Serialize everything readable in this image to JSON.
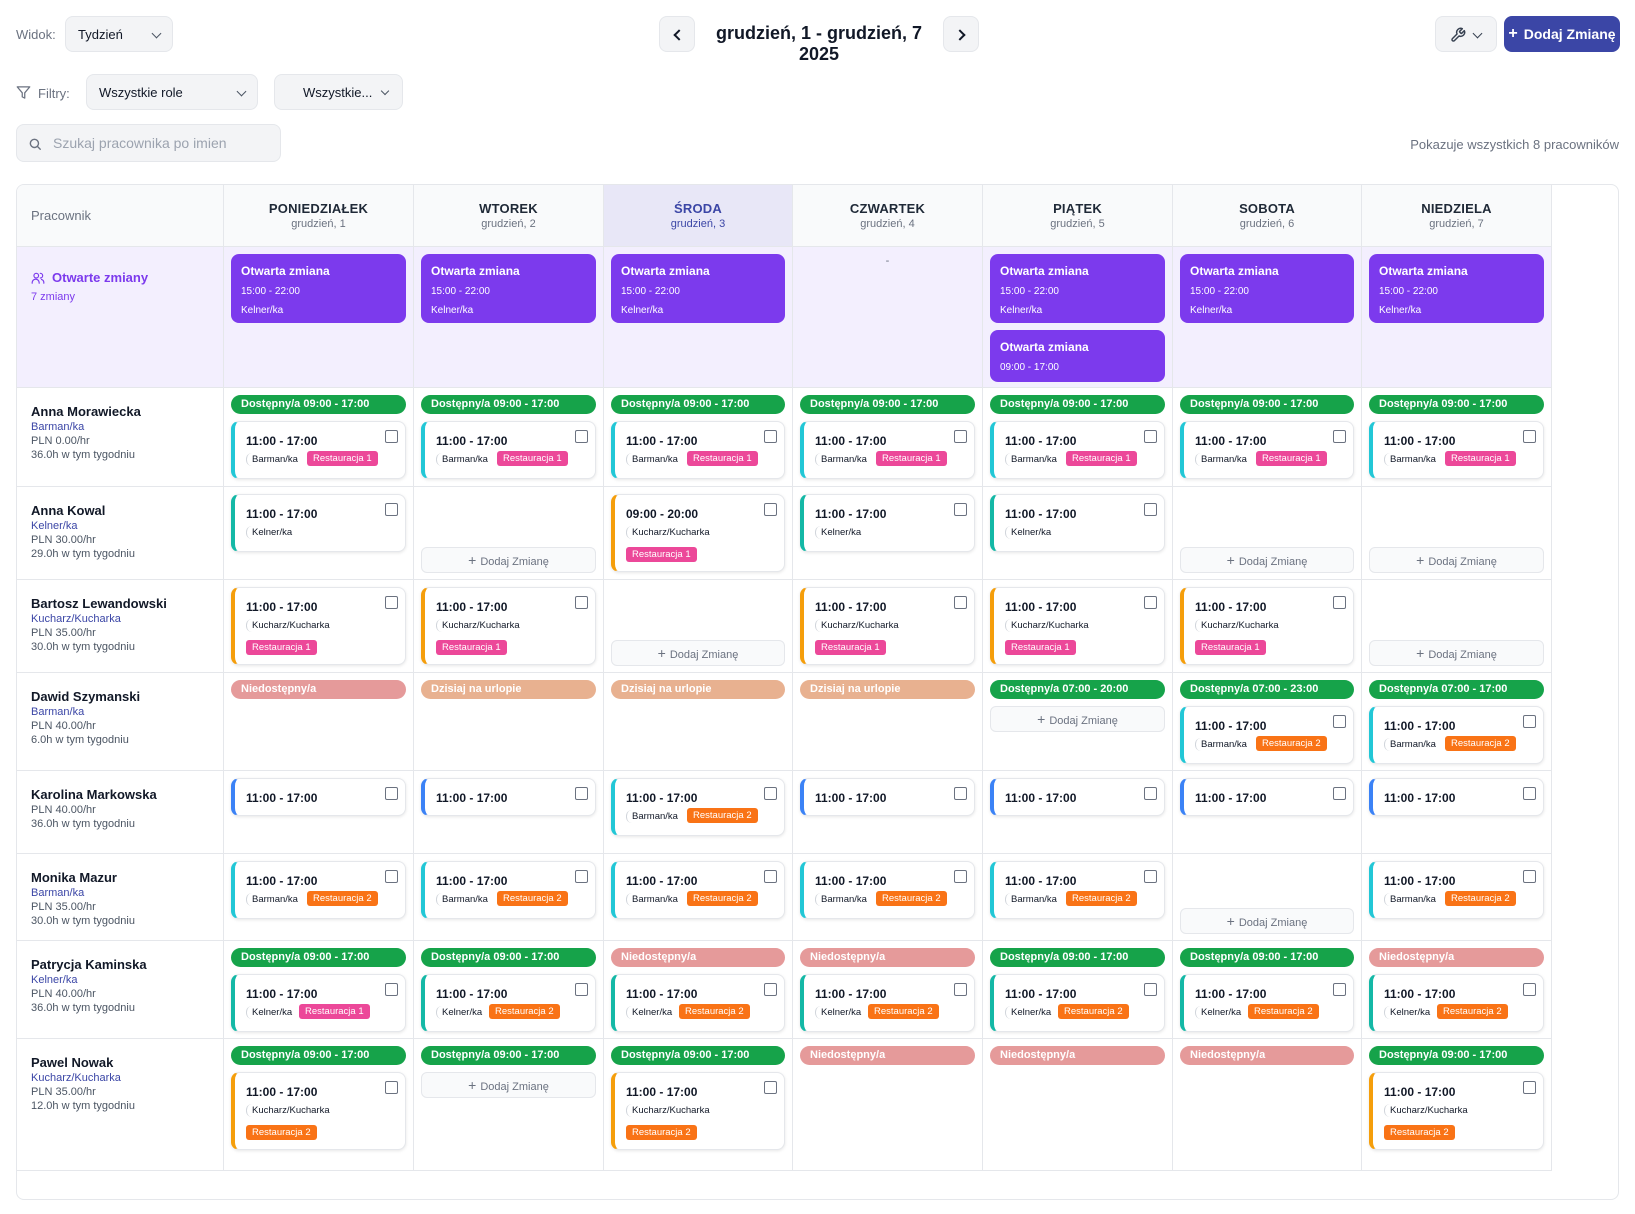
{
  "toolbar": {
    "view_label": "Widok:",
    "view_value": "Tydzień",
    "week_range": "grudzień, 1 - grudzień, 7 2025",
    "add_shift_label": "Dodaj Zmianę"
  },
  "filters": {
    "label": "Filtry:",
    "role_value": "Wszystkie role",
    "location_value": "Wszystkie..."
  },
  "search": {
    "placeholder": "Szukaj pracownika po imien"
  },
  "showing_count": "Pokazuje wszystkich 8 pracowników",
  "colors": {
    "primary": "#3b46a6",
    "open_shift": "#7c3aed",
    "available": "#16a34a",
    "unavailable": "#e59a9a",
    "leave": "#e8b190",
    "location_1": "#ec4899",
    "location_2": "#f97316"
  },
  "grid": {
    "employee_header": "Pracownik",
    "days": [
      {
        "name": "PONIEDZIAŁEK",
        "date": "grudzień, 1"
      },
      {
        "name": "WTOREK",
        "date": "grudzień, 2"
      },
      {
        "name": "ŚRODA",
        "date": "grudzień, 3",
        "today": true
      },
      {
        "name": "CZWARTEK",
        "date": "grudzień, 4"
      },
      {
        "name": "PIĄTEK",
        "date": "grudzień, 5"
      },
      {
        "name": "SOBOTA",
        "date": "grudzień, 6"
      },
      {
        "name": "NIEDZIELA",
        "date": "grudzień, 7"
      }
    ],
    "add_shift_label": "Dodaj Zmianę",
    "open_shifts": {
      "label": "Otwarte zmiany",
      "count": "7 zmiany",
      "empty_marker": "-",
      "days": [
        [
          {
            "title": "Otwarta zmiana",
            "hours": "15:00 - 22:00",
            "role": "Kelner/ka"
          }
        ],
        [
          {
            "title": "Otwarta zmiana",
            "hours": "15:00 - 22:00",
            "role": "Kelner/ka"
          }
        ],
        [
          {
            "title": "Otwarta zmiana",
            "hours": "15:00 - 22:00",
            "role": "Kelner/ka"
          }
        ],
        [],
        [
          {
            "title": "Otwarta zmiana",
            "hours": "15:00 - 22:00",
            "role": "Kelner/ka"
          },
          {
            "title": "Otwarta zmiana",
            "hours": "09:00 - 17:00"
          }
        ],
        [
          {
            "title": "Otwarta zmiana",
            "hours": "15:00 - 22:00",
            "role": "Kelner/ka"
          }
        ],
        [
          {
            "title": "Otwarta zmiana",
            "hours": "15:00 - 22:00",
            "role": "Kelner/ka"
          }
        ]
      ]
    },
    "employees": [
      {
        "name": "Anna Morawiecka",
        "role": "Barman/ka",
        "rate": "PLN 0.00/hr",
        "hours": "36.0h w tym tygodniu",
        "days": [
          {
            "pill": {
              "type": "avail",
              "text": "Dostępny/a 09:00 - 17:00"
            },
            "shift": {
              "time": "11:00 - 17:00",
              "role": "Barman/ka",
              "loc": "Restauracja 1",
              "loc_type": "r1",
              "color": "#22c7d6",
              "layout": "inline"
            }
          },
          {
            "pill": {
              "type": "avail",
              "text": "Dostępny/a 09:00 - 17:00"
            },
            "shift": {
              "time": "11:00 - 17:00",
              "role": "Barman/ka",
              "loc": "Restauracja 1",
              "loc_type": "r1",
              "color": "#22c7d6",
              "layout": "inline"
            }
          },
          {
            "pill": {
              "type": "avail",
              "text": "Dostępny/a 09:00 - 17:00"
            },
            "shift": {
              "time": "11:00 - 17:00",
              "role": "Barman/ka",
              "loc": "Restauracja 1",
              "loc_type": "r1",
              "color": "#22c7d6",
              "layout": "inline"
            }
          },
          {
            "pill": {
              "type": "avail",
              "text": "Dostępny/a 09:00 - 17:00"
            },
            "shift": {
              "time": "11:00 - 17:00",
              "role": "Barman/ka",
              "loc": "Restauracja 1",
              "loc_type": "r1",
              "color": "#22c7d6",
              "layout": "inline"
            }
          },
          {
            "pill": {
              "type": "avail",
              "text": "Dostępny/a 09:00 - 17:00"
            },
            "shift": {
              "time": "11:00 - 17:00",
              "role": "Barman/ka",
              "loc": "Restauracja 1",
              "loc_type": "r1",
              "color": "#22c7d6",
              "layout": "inline"
            }
          },
          {
            "pill": {
              "type": "avail",
              "text": "Dostępny/a 09:00 - 17:00"
            },
            "shift": {
              "time": "11:00 - 17:00",
              "role": "Barman/ka",
              "loc": "Restauracja 1",
              "loc_type": "r1",
              "color": "#22c7d6",
              "layout": "inline"
            }
          },
          {
            "pill": {
              "type": "avail",
              "text": "Dostępny/a 09:00 - 17:00"
            },
            "shift": {
              "time": "11:00 - 17:00",
              "role": "Barman/ka",
              "loc": "Restauracja 1",
              "loc_type": "r1",
              "color": "#22c7d6",
              "layout": "inline"
            }
          }
        ]
      },
      {
        "name": "Anna Kowal",
        "role": "Kelner/ka",
        "rate": "PLN 30.00/hr",
        "hours": "29.0h w tym tygodniu",
        "days": [
          {
            "shift": {
              "time": "11:00 - 17:00",
              "role": "Kelner/ka",
              "color": "#14b8a6",
              "layout": "role-only"
            }
          },
          {
            "add": true
          },
          {
            "shift": {
              "time": "09:00 - 20:00",
              "role": "Kucharz/Kucharka",
              "loc": "Restauracja 1",
              "loc_type": "r1",
              "color": "#f59e0b",
              "layout": "stacked"
            }
          },
          {
            "shift": {
              "time": "11:00 - 17:00",
              "role": "Kelner/ka",
              "color": "#14b8a6",
              "layout": "role-only"
            }
          },
          {
            "shift": {
              "time": "11:00 - 17:00",
              "role": "Kelner/ka",
              "color": "#14b8a6",
              "layout": "role-only"
            }
          },
          {
            "add": true
          },
          {
            "add": true
          }
        ]
      },
      {
        "name": "Bartosz Lewandowski",
        "role": "Kucharz/Kucharka",
        "rate": "PLN 35.00/hr",
        "hours": "30.0h w tym tygodniu",
        "days": [
          {
            "shift": {
              "time": "11:00 - 17:00",
              "role": "Kucharz/Kucharka",
              "loc": "Restauracja 1",
              "loc_type": "r1",
              "color": "#f59e0b",
              "layout": "stacked"
            }
          },
          {
            "shift": {
              "time": "11:00 - 17:00",
              "role": "Kucharz/Kucharka",
              "loc": "Restauracja 1",
              "loc_type": "r1",
              "color": "#f59e0b",
              "layout": "stacked"
            }
          },
          {
            "add": true
          },
          {
            "shift": {
              "time": "11:00 - 17:00",
              "role": "Kucharz/Kucharka",
              "loc": "Restauracja 1",
              "loc_type": "r1",
              "color": "#f59e0b",
              "layout": "stacked"
            }
          },
          {
            "shift": {
              "time": "11:00 - 17:00",
              "role": "Kucharz/Kucharka",
              "loc": "Restauracja 1",
              "loc_type": "r1",
              "color": "#f59e0b",
              "layout": "stacked"
            }
          },
          {
            "shift": {
              "time": "11:00 - 17:00",
              "role": "Kucharz/Kucharka",
              "loc": "Restauracja 1",
              "loc_type": "r1",
              "color": "#f59e0b",
              "layout": "stacked"
            }
          },
          {
            "add": true
          }
        ]
      },
      {
        "name": "Dawid Szymanski",
        "role": "Barman/ka",
        "rate": "PLN 40.00/hr",
        "hours": "6.0h w tym tygodniu",
        "days": [
          {
            "pill": {
              "type": "unavail",
              "text": "Niedostępny/a"
            }
          },
          {
            "pill": {
              "type": "leave",
              "text": "Dzisiaj na urlopie"
            }
          },
          {
            "pill": {
              "type": "leave",
              "text": "Dzisiaj na urlopie"
            }
          },
          {
            "pill": {
              "type": "leave",
              "text": "Dzisiaj na urlopie"
            }
          },
          {
            "pill": {
              "type": "avail",
              "text": "Dostępny/a 07:00 - 20:00"
            },
            "add": true
          },
          {
            "pill": {
              "type": "avail",
              "text": "Dostępny/a 07:00 - 23:00"
            },
            "shift": {
              "time": "11:00 - 17:00",
              "role": "Barman/ka",
              "loc": "Restauracja 2",
              "loc_type": "r2",
              "color": "#22c7d6",
              "layout": "inline"
            }
          },
          {
            "pill": {
              "type": "avail",
              "text": "Dostępny/a 07:00 - 17:00"
            },
            "shift": {
              "time": "11:00 - 17:00",
              "role": "Barman/ka",
              "loc": "Restauracja 2",
              "loc_type": "r2",
              "color": "#22c7d6",
              "layout": "inline"
            }
          }
        ]
      },
      {
        "name": "Karolina Markowska",
        "role": "",
        "rate": "PLN 40.00/hr",
        "hours": "36.0h w tym tygodniu",
        "days": [
          {
            "shift": {
              "time": "11:00 - 17:00",
              "color": "#3b82f6",
              "layout": "time-only"
            }
          },
          {
            "shift": {
              "time": "11:00 - 17:00",
              "color": "#3b82f6",
              "layout": "time-only"
            }
          },
          {
            "shift": {
              "time": "11:00 - 17:00",
              "role": "Barman/ka",
              "loc": "Restauracja 2",
              "loc_type": "r2",
              "color": "#22c7d6",
              "layout": "inline"
            }
          },
          {
            "shift": {
              "time": "11:00 - 17:00",
              "color": "#3b82f6",
              "layout": "time-only"
            }
          },
          {
            "shift": {
              "time": "11:00 - 17:00",
              "color": "#3b82f6",
              "layout": "time-only"
            }
          },
          {
            "shift": {
              "time": "11:00 - 17:00",
              "color": "#3b82f6",
              "layout": "time-only"
            }
          },
          {
            "shift": {
              "time": "11:00 - 17:00",
              "color": "#3b82f6",
              "layout": "time-only"
            }
          }
        ]
      },
      {
        "name": "Monika Mazur",
        "role": "Barman/ka",
        "rate": "PLN 35.00/hr",
        "hours": "30.0h w tym tygodniu",
        "days": [
          {
            "shift": {
              "time": "11:00 - 17:00",
              "role": "Barman/ka",
              "loc": "Restauracja 2",
              "loc_type": "r2",
              "color": "#22c7d6",
              "layout": "inline"
            }
          },
          {
            "shift": {
              "time": "11:00 - 17:00",
              "role": "Barman/ka",
              "loc": "Restauracja 2",
              "loc_type": "r2",
              "color": "#22c7d6",
              "layout": "inline"
            }
          },
          {
            "shift": {
              "time": "11:00 - 17:00",
              "role": "Barman/ka",
              "loc": "Restauracja 2",
              "loc_type": "r2",
              "color": "#22c7d6",
              "layout": "inline"
            }
          },
          {
            "shift": {
              "time": "11:00 - 17:00",
              "role": "Barman/ka",
              "loc": "Restauracja 2",
              "loc_type": "r2",
              "color": "#22c7d6",
              "layout": "inline"
            }
          },
          {
            "shift": {
              "time": "11:00 - 17:00",
              "role": "Barman/ka",
              "loc": "Restauracja 2",
              "loc_type": "r2",
              "color": "#22c7d6",
              "layout": "inline"
            }
          },
          {
            "add": true
          },
          {
            "shift": {
              "time": "11:00 - 17:00",
              "role": "Barman/ka",
              "loc": "Restauracja 2",
              "loc_type": "r2",
              "color": "#22c7d6",
              "layout": "inline"
            }
          }
        ]
      },
      {
        "name": "Patrycja Kaminska",
        "role": "Kelner/ka",
        "rate": "PLN 40.00/hr",
        "hours": "36.0h w tym tygodniu",
        "days": [
          {
            "pill": {
              "type": "avail",
              "text": "Dostępny/a 09:00 - 17:00"
            },
            "shift": {
              "time": "11:00 - 17:00",
              "role": "Kelner/ka",
              "loc": "Restauracja 1",
              "loc_type": "r1",
              "color": "#14b8a6",
              "layout": "inline"
            }
          },
          {
            "pill": {
              "type": "avail",
              "text": "Dostępny/a 09:00 - 17:00"
            },
            "shift": {
              "time": "11:00 - 17:00",
              "role": "Kelner/ka",
              "loc": "Restauracja 2",
              "loc_type": "r2",
              "color": "#14b8a6",
              "layout": "inline"
            }
          },
          {
            "pill": {
              "type": "unavail",
              "text": "Niedostępny/a"
            },
            "shift": {
              "time": "11:00 - 17:00",
              "role": "Kelner/ka",
              "loc": "Restauracja 2",
              "loc_type": "r2",
              "color": "#14b8a6",
              "layout": "inline"
            }
          },
          {
            "pill": {
              "type": "unavail",
              "text": "Niedostępny/a"
            },
            "shift": {
              "time": "11:00 - 17:00",
              "role": "Kelner/ka",
              "loc": "Restauracja 2",
              "loc_type": "r2",
              "color": "#14b8a6",
              "layout": "inline"
            }
          },
          {
            "pill": {
              "type": "avail",
              "text": "Dostępny/a 09:00 - 17:00"
            },
            "shift": {
              "time": "11:00 - 17:00",
              "role": "Kelner/ka",
              "loc": "Restauracja 2",
              "loc_type": "r2",
              "color": "#14b8a6",
              "layout": "inline"
            }
          },
          {
            "pill": {
              "type": "avail",
              "text": "Dostępny/a 09:00 - 17:00"
            },
            "shift": {
              "time": "11:00 - 17:00",
              "role": "Kelner/ka",
              "loc": "Restauracja 2",
              "loc_type": "r2",
              "color": "#14b8a6",
              "layout": "inline"
            }
          },
          {
            "pill": {
              "type": "unavail",
              "text": "Niedostępny/a"
            },
            "shift": {
              "time": "11:00 - 17:00",
              "role": "Kelner/ka",
              "loc": "Restauracja 2",
              "loc_type": "r2",
              "color": "#14b8a6",
              "layout": "inline"
            }
          }
        ]
      },
      {
        "name": "Pawel Nowak",
        "role": "Kucharz/Kucharka",
        "rate": "PLN 35.00/hr",
        "hours": "12.0h w tym tygodniu",
        "days": [
          {
            "pill": {
              "type": "avail",
              "text": "Dostępny/a 09:00 - 17:00"
            },
            "shift": {
              "time": "11:00 - 17:00",
              "role": "Kucharz/Kucharka",
              "loc": "Restauracja 2",
              "loc_type": "r2",
              "color": "#f59e0b",
              "layout": "stacked"
            }
          },
          {
            "pill": {
              "type": "avail",
              "text": "Dostępny/a 09:00 - 17:00"
            },
            "add": true
          },
          {
            "pill": {
              "type": "avail",
              "text": "Dostępny/a 09:00 - 17:00"
            },
            "shift": {
              "time": "11:00 - 17:00",
              "role": "Kucharz/Kucharka",
              "loc": "Restauracja 2",
              "loc_type": "r2",
              "color": "#f59e0b",
              "layout": "stacked"
            }
          },
          {
            "pill": {
              "type": "unavail",
              "text": "Niedostępny/a"
            }
          },
          {
            "pill": {
              "type": "unavail",
              "text": "Niedostępny/a"
            }
          },
          {
            "pill": {
              "type": "unavail",
              "text": "Niedostępny/a"
            }
          },
          {
            "pill": {
              "type": "avail",
              "text": "Dostępny/a 09:00 - 17:00"
            },
            "shift": {
              "time": "11:00 - 17:00",
              "role": "Kucharz/Kucharka",
              "loc": "Restauracja 2",
              "loc_type": "r2",
              "color": "#f59e0b",
              "layout": "stacked"
            }
          }
        ]
      }
    ]
  }
}
